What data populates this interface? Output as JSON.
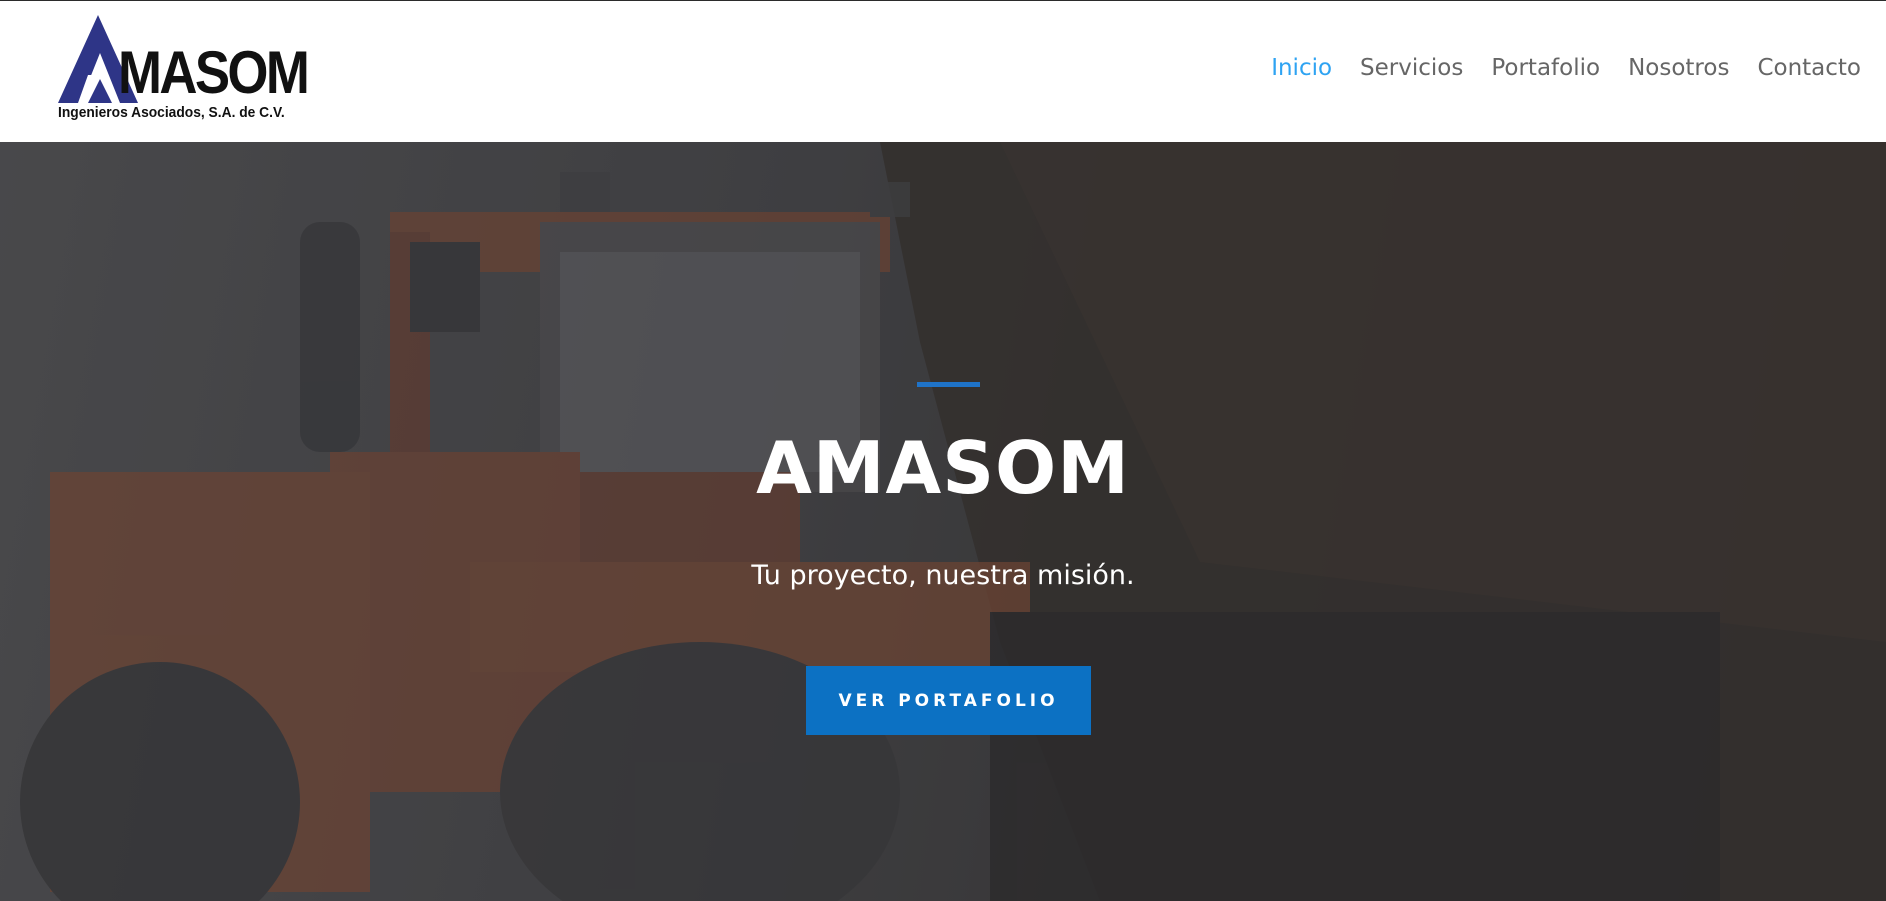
{
  "brand": {
    "logo_text": "MASOM",
    "logo_subtitle": "Ingenieros Asociados, S.A. de C.V.",
    "logo_color": "#2e3587"
  },
  "nav": {
    "items": [
      {
        "label": "Inicio",
        "active": true
      },
      {
        "label": "Servicios",
        "active": false
      },
      {
        "label": "Portafolio",
        "active": false
      },
      {
        "label": "Nosotros",
        "active": false
      },
      {
        "label": "Contacto",
        "active": false
      }
    ],
    "active_color": "#2ea3f2",
    "text_color": "#666666"
  },
  "hero": {
    "title": "AMASOM",
    "subtitle": "Tu proyecto, nuestra misión.",
    "button_label": "VER PORTAFOLIO",
    "accent_color": "#0c71c3",
    "background_image": "wheel-loader-construction-photo"
  }
}
